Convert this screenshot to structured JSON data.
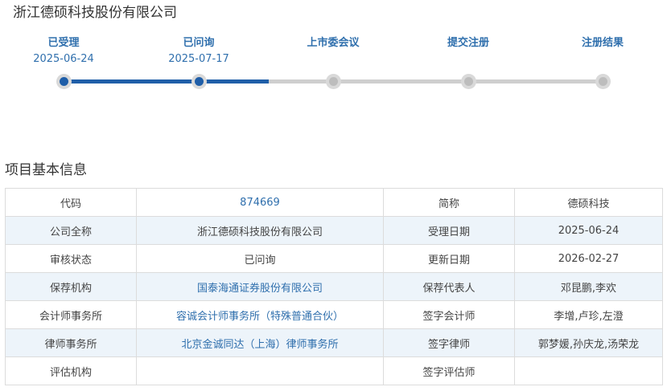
{
  "company_title": "浙江德硕科技股份有限公司",
  "steps": [
    {
      "label": "已受理",
      "date": "2025-06-24",
      "done": true
    },
    {
      "label": "已问询",
      "date": "2025-07-17",
      "done": true
    },
    {
      "label": "上市委会议",
      "date": "",
      "done": false
    },
    {
      "label": "提交注册",
      "date": "",
      "done": false
    },
    {
      "label": "注册结果",
      "date": "",
      "done": false
    }
  ],
  "progress_fraction": 0.38,
  "section_title": "项目基本信息",
  "info_rows": [
    {
      "k1": "代码",
      "v1": "874669",
      "k2": "简称",
      "v2": "德硕科技"
    },
    {
      "k1": "公司全称",
      "v1": "浙江德硕科技股份有限公司",
      "k2": "受理日期",
      "v2": "2025-06-24"
    },
    {
      "k1": "审核状态",
      "v1": "已问询",
      "k2": "更新日期",
      "v2": "2026-02-27"
    },
    {
      "k1": "保荐机构",
      "v1": "国泰海通证券股份有限公司",
      "k2": "保荐代表人",
      "v2": "邓昆鹏,李欢"
    },
    {
      "k1": "会计师事务所",
      "v1": "容诚会计师事务所（特殊普通合伙）",
      "k2": "签字会计师",
      "v2": "李增,卢珍,左澄"
    },
    {
      "k1": "律师事务所",
      "v1": "北京金诚同达（上海）律师事务所",
      "k2": "签字律师",
      "v2": "郭梦媛,孙庆龙,汤荣龙"
    },
    {
      "k1": "评估机构",
      "v1": "",
      "k2": "签字评估师",
      "v2": ""
    }
  ],
  "colors": {
    "accent": "#1f5ea8",
    "link": "#2f6fad",
    "stripe": "#edf4fa",
    "border": "#dcdcdc",
    "inactive": "#bdbdbd"
  }
}
